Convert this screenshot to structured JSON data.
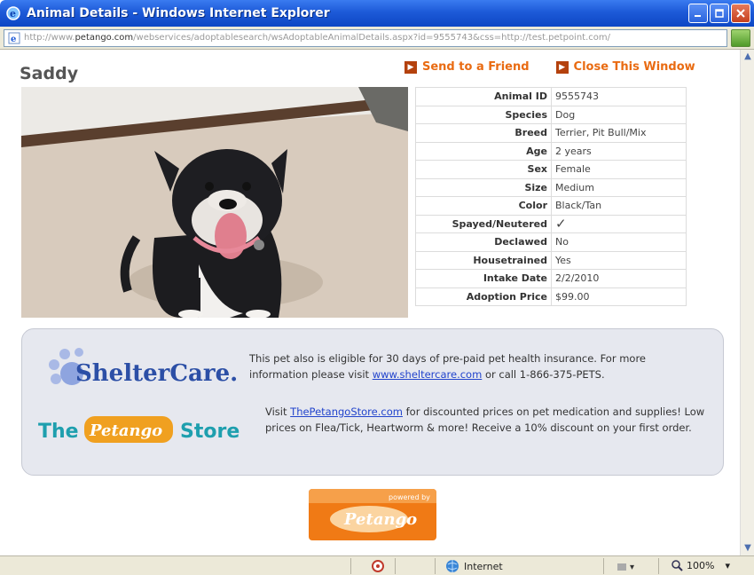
{
  "window": {
    "title": "Animal Details - Windows Internet Explorer",
    "address_prefix": "http://www.",
    "address_host": "petango.com",
    "address_rest": "/webservices/adoptablesearch/wsAdoptableAnimalDetails.aspx?id=9555743&css=http://test.petpoint.com/"
  },
  "pet": {
    "name": "Saddy"
  },
  "links": {
    "send": "Send to a Friend",
    "close": "Close This Window"
  },
  "details": [
    {
      "key": "Animal ID",
      "value": "9555743"
    },
    {
      "key": "Species",
      "value": "Dog"
    },
    {
      "key": "Breed",
      "value": "Terrier, Pit Bull/Mix"
    },
    {
      "key": "Age",
      "value": "2 years"
    },
    {
      "key": "Sex",
      "value": "Female"
    },
    {
      "key": "Size",
      "value": "Medium"
    },
    {
      "key": "Color",
      "value": "Black/Tan"
    },
    {
      "key": "Spayed/Neutered",
      "value": "✓"
    },
    {
      "key": "Declawed",
      "value": "No"
    },
    {
      "key": "Housetrained",
      "value": "Yes"
    },
    {
      "key": "Intake Date",
      "value": "2/2/2010"
    },
    {
      "key": "Adoption Price",
      "value": "$99.00"
    }
  ],
  "promo": {
    "sheltercare_logo": "ShelterCare.",
    "sheltercare_text_before": "This pet also is eligible for 30 days of pre-paid pet health insurance. For more information please visit ",
    "sheltercare_link": "www.sheltercare.com",
    "sheltercare_text_after": " or call 1-866-375-PETS.",
    "store_logo_left": "The",
    "store_logo_mid": "Petango",
    "store_logo_right": "Store",
    "store_text_before": "Visit ",
    "store_link": "ThePetangoStore.com",
    "store_text_after": " for discounted prices on pet medication and supplies! Low prices on Flea/Tick, Heartworm & more! Receive a 10% discount on your first order."
  },
  "powered": {
    "top": "powered by",
    "brand": "Petango"
  },
  "status": {
    "zone": "Internet",
    "zoom": "100%"
  },
  "colors": {
    "link_orange": "#e96b12",
    "titlebar_blue": "#1d5ad8",
    "check_green": "#2f9d1f"
  }
}
